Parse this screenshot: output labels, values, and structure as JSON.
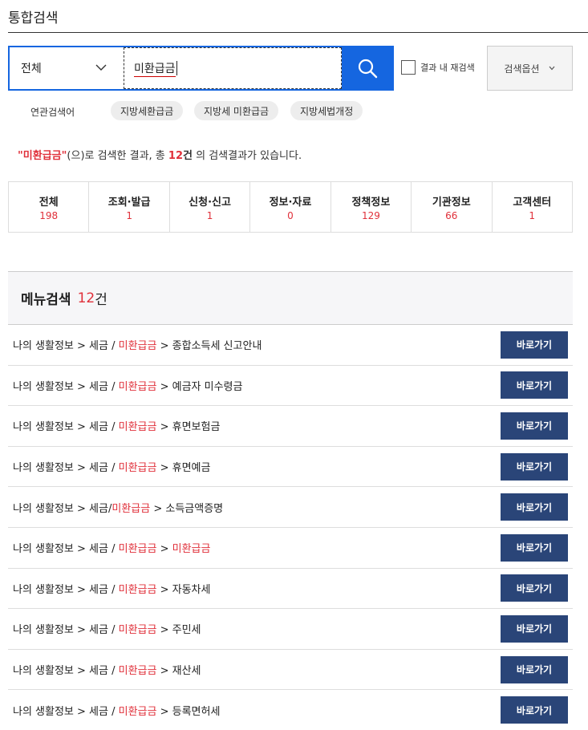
{
  "header": {
    "title": "통합검색"
  },
  "search": {
    "scope_value": "전체",
    "query": "미환급금",
    "within_results_label": "결과 내 재검색",
    "options_label": "검색옵션"
  },
  "related": {
    "label": "연관검색어",
    "tags": [
      "지방세환급금",
      "지방세 미환급금",
      "지방세법개정"
    ]
  },
  "summary": {
    "quote_open": "\"",
    "keyword": "미환급금",
    "quote_close": "\"",
    "middle": "(으)로 검색한 결과, 총 ",
    "count": "12",
    "unit": "건",
    "suffix": " 의 검색결과가 있습니다."
  },
  "categories": [
    {
      "name": "전체",
      "count": "198"
    },
    {
      "name": "조회·발급",
      "count": "1"
    },
    {
      "name": "신청·신고",
      "count": "1"
    },
    {
      "name": "정보·자료",
      "count": "0"
    },
    {
      "name": "정책정보",
      "count": "129"
    },
    {
      "name": "기관정보",
      "count": "66"
    },
    {
      "name": "고객센터",
      "count": "1"
    }
  ],
  "menu_section": {
    "title": "메뉴검색",
    "count": "12",
    "unit": "건"
  },
  "results": [
    {
      "prefix": "나의 생활정보 > 세금 / ",
      "keyword": "미환급금",
      "suffix": " > 종합소득세 신고안내"
    },
    {
      "prefix": "나의 생활정보 > 세금 / ",
      "keyword": "미환급금",
      "suffix": " > 예금자 미수령금"
    },
    {
      "prefix": "나의 생활정보 > 세금 / ",
      "keyword": "미환급금",
      "suffix": " > 휴면보험금"
    },
    {
      "prefix": "나의 생활정보 > 세금 / ",
      "keyword": "미환급금",
      "suffix": " > 휴면예금"
    },
    {
      "prefix": "나의 생활정보 > 세금/",
      "keyword": "미환급금",
      "suffix": " > 소득금액증명"
    },
    {
      "prefix": "나의 생활정보 > 세금 / ",
      "keyword": "미환급금",
      "suffix": " > ",
      "keyword2": "미환급금"
    },
    {
      "prefix": "나의 생활정보 > 세금 / ",
      "keyword": "미환급금",
      "suffix": " > 자동차세"
    },
    {
      "prefix": "나의 생활정보 > 세금 / ",
      "keyword": "미환급금",
      "suffix": " > 주민세"
    },
    {
      "prefix": "나의 생활정보 > 세금 / ",
      "keyword": "미환급금",
      "suffix": " > 재산세"
    },
    {
      "prefix": "나의 생활정보 > 세금 / ",
      "keyword": "미환급금",
      "suffix": " > 등록면허세"
    }
  ],
  "result_button_label": "바로가기",
  "colors": {
    "accent_blue": "#1566e0",
    "highlight_red": "#e0303a",
    "button_navy": "#2a4578"
  },
  "icons": {
    "scope_chevron": "chevron-down-icon",
    "search": "search-icon",
    "options_chevron": "chevron-down-icon"
  }
}
